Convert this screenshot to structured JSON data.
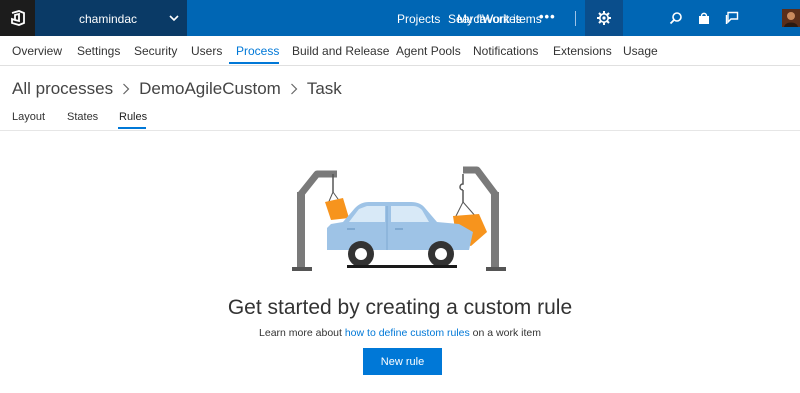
{
  "topbar": {
    "account_name": "chamindac",
    "links": [
      "Projects",
      "Search",
      "My favorites",
      "Work items"
    ],
    "more_label": "•••",
    "icons": [
      "vsts-logo-icon",
      "chevron-down-icon",
      "gear-icon",
      "search-icon",
      "shopping-bag-icon",
      "feedback-icon",
      "avatar"
    ]
  },
  "admin_nav": {
    "tabs": [
      "Overview",
      "Settings",
      "Security",
      "Users",
      "Process",
      "Build and Release",
      "Agent Pools",
      "Notifications",
      "Extensions",
      "Usage"
    ],
    "active_tab": "Process"
  },
  "breadcrumb": {
    "items": [
      "All processes",
      "DemoAgileCustom",
      "Task"
    ]
  },
  "sub_tabs": {
    "tabs": [
      "Layout",
      "States",
      "Rules"
    ],
    "active_tab": "Rules"
  },
  "empty_state": {
    "title": "Get started by creating a custom rule",
    "desc_before": "Learn more about ",
    "desc_link": "how to define custom rules",
    "desc_after": " on a work item",
    "button_label": "New rule"
  },
  "colors": {
    "topbar": "#0066b4",
    "accent": "#0078d7",
    "car_body": "#9ec3e6",
    "orange": "#f7941d",
    "crane": "#7a7a7a"
  }
}
